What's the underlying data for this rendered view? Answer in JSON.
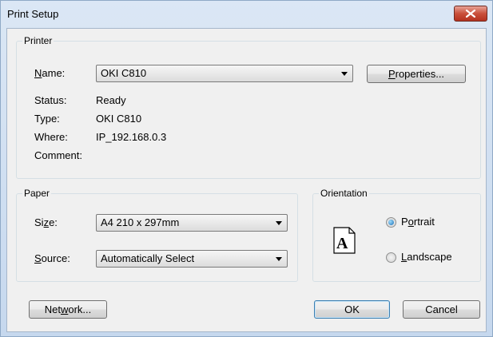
{
  "window": {
    "title": "Print Setup"
  },
  "printer": {
    "group_label": "Printer",
    "name_label": "N",
    "name_label_rest": "ame:",
    "name_value": "OKI C810",
    "properties_u": "P",
    "properties_rest": "roperties...",
    "status_label": "Status:",
    "status_value": "Ready",
    "type_label": "Type:",
    "type_value": "OKI C810",
    "where_label": "Where:",
    "where_value": "IP_192.168.0.3",
    "comment_label": "Comment:",
    "comment_value": ""
  },
  "paper": {
    "group_label": "Paper",
    "size_label_a": "Si",
    "size_label_u": "z",
    "size_label_b": "e:",
    "size_value": "A4 210 x 297mm",
    "source_label_u": "S",
    "source_label_rest": "ource:",
    "source_value": "Automatically Select"
  },
  "orientation": {
    "group_label": "Orientation",
    "icon_letter": "A",
    "portrait_a": "P",
    "portrait_u": "o",
    "portrait_b": "rtrait",
    "landscape_u": "L",
    "landscape_rest": "andscape",
    "selected": "portrait"
  },
  "buttons": {
    "network_a": "Net",
    "network_u": "w",
    "network_b": "ork...",
    "ok": "OK",
    "cancel": "Cancel"
  }
}
